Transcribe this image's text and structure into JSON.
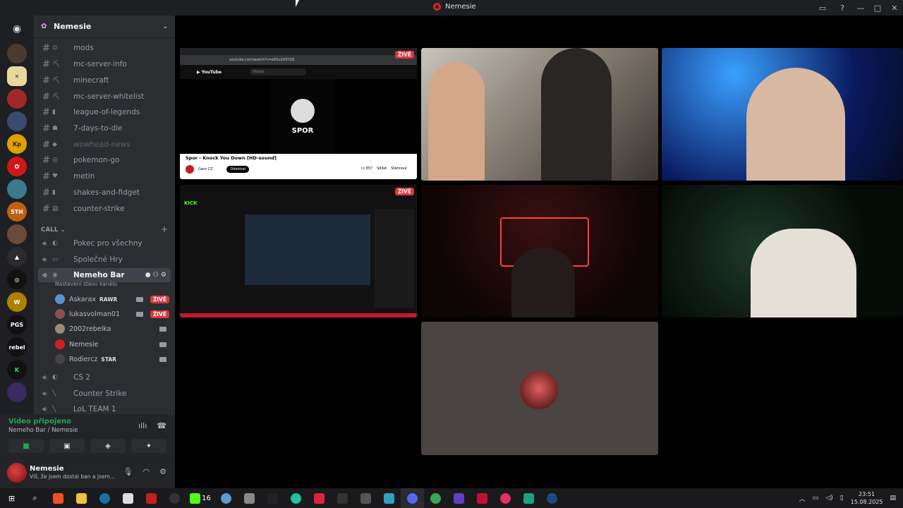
{
  "window": {
    "title": "Nemesie"
  },
  "guild": {
    "name": "Nemesie"
  },
  "text_channels": [
    {
      "name": "mods",
      "emoji": "⊙"
    },
    {
      "name": "mc-server-info",
      "emoji": "⛏"
    },
    {
      "name": "minecraft",
      "emoji": "⛏"
    },
    {
      "name": "mc-server-whitelist",
      "emoji": "⛏"
    },
    {
      "name": "league-of-legends",
      "emoji": "▮"
    },
    {
      "name": "7-days-to-die",
      "emoji": "☗"
    },
    {
      "name": "wowhead-news",
      "emoji": "◆"
    },
    {
      "name": "pokemon-go",
      "emoji": "◎"
    },
    {
      "name": "metin",
      "emoji": "♥"
    },
    {
      "name": "shakes-and-fidget",
      "emoji": "▮"
    },
    {
      "name": "counter-strike",
      "emoji": "▤"
    }
  ],
  "category": {
    "label": "CALL",
    "plus": "+"
  },
  "voice_channels": [
    {
      "name": "Pokec pro všechny",
      "emoji": "◐"
    },
    {
      "name": "Společné Hry",
      "emoji": "▭"
    },
    {
      "name": "Nemeho Bar",
      "emoji": "◉"
    },
    {
      "name": "CS 2",
      "emoji": "◐"
    },
    {
      "name": "Counter Strike",
      "emoji": "╲"
    },
    {
      "name": "LoL TEAM 1",
      "emoji": "╲"
    }
  ],
  "active_channel_sub": "Nastavení stavu kanálu",
  "members": [
    {
      "name": "Askarax",
      "tag": "RAWR",
      "live": "ŽIVĚ",
      "color": "#5a8fd0"
    },
    {
      "name": "lukasvolman01",
      "tag": "",
      "live": "ŽIVĚ",
      "color": "#8a5050"
    },
    {
      "name": "2002rebelka",
      "tag": "",
      "live": "",
      "color": "#9a8a7a"
    },
    {
      "name": "Nemesie",
      "tag": "",
      "live": "",
      "color": "#d02020"
    },
    {
      "name": "Rodiercz",
      "tag": "STAR",
      "live": "",
      "color": "#444"
    }
  ],
  "voice_panel": {
    "status": "Video připojeno",
    "location": "Nemeho Bar / Nemesie"
  },
  "user": {
    "name": "Nemesie",
    "status": "Víš, že jsem dostal ban a jsem..."
  },
  "tiles": {
    "youtube": {
      "live": "ŽIVĚ",
      "url": "youtube.com/watch?v=eD0u2V0Y2Q",
      "search_placeholder": "Hledat",
      "video_title": "Spor - Knock You Down [HD-sound]",
      "channel": "Gero CZ",
      "subscribe": "Odebírat",
      "likes": "857",
      "share": "Sdílet",
      "download": "Stáhnout",
      "logo_text": "SPOR"
    },
    "kick": {
      "live": "ŽIVĚ",
      "logo": "KICK"
    }
  },
  "taskbar": {
    "badge": "16",
    "time": "23:51",
    "date": "15.08.2025"
  },
  "colors": {
    "accent": "#5865f2",
    "live": "#da373c",
    "connected": "#23a55a"
  }
}
